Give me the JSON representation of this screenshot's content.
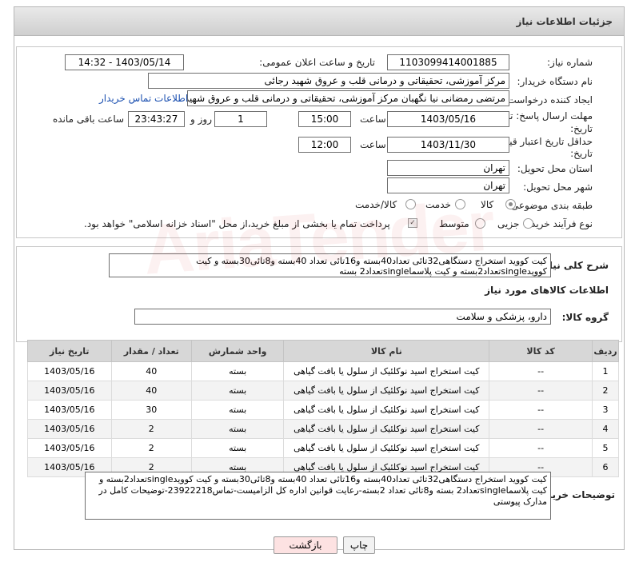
{
  "header": {
    "title": "جزئیات اطلاعات نیاز"
  },
  "fields": {
    "need_number_label": "شماره نیاز:",
    "need_number": "1103099414001885",
    "announce_label": "تاریخ و ساعت اعلان عمومی:",
    "announce_value": "1403/05/14 - 14:32",
    "buyer_label": "نام دستگاه خریدار:",
    "buyer_value": "مرکز آموزشی، تحقیقاتی و درمانی قلب و عروق شهید رجائی",
    "creator_label": "ایجاد کننده درخواست:",
    "creator_value": "مرتضی رمضانی نیا نگهبان مرکز آموزشی، تحقیقاتی و درمانی قلب و عروق شهید",
    "buyer_contact_link": "اطلاعات تماس خریدار",
    "deadline_label_1": "مهلت ارسال پاسخ: تا",
    "deadline_label_2": "تاریخ:",
    "deadline_date": "1403/05/16",
    "time_label": "ساعت",
    "deadline_time": "15:00",
    "days_value": "1",
    "days_label": "روز و",
    "remaining_time": "23:43:27",
    "remaining_label": "ساعت باقی مانده",
    "validity_label_1": "حداقل تاریخ اعتبار قیمت: تا",
    "validity_label_2": "تاریخ:",
    "validity_date": "1403/11/30",
    "validity_time_label": "ساعت",
    "validity_time": "12:00",
    "province_label": "استان محل تحویل:",
    "province_value": "تهران",
    "city_label": "شهر محل تحویل:",
    "city_value": "تهران",
    "category_label": "طبقه بندی موضوعی:",
    "category_options": [
      "کالا",
      "خدمت",
      "کالا/خدمت"
    ],
    "category_selected": "کالا",
    "process_label": "نوع فرآیند خرید :",
    "process_options": [
      "جزیی",
      "متوسط"
    ],
    "payment_note": "پرداخت تمام یا بخشی از مبلغ خرید،از محل \"اسناد خزانه اسلامی\" خواهد بود."
  },
  "description": {
    "label": "شرح کلی نیاز:",
    "text": "کیت کووید استخراج دستگاهی32تائی تعداد40بسته و16تائی تعداد 40بسته و8تائی30بسته و کیت کوویدsingleتعداد2بسته و کیت پلاسماsingleتعداد2 بسته"
  },
  "goods": {
    "section_title": "اطلاعات کالاهای مورد نیاز",
    "group_label": "گروه کالا:",
    "group_value": "دارو، پزشکی و سلامت",
    "columns": [
      "ردیف",
      "کد کالا",
      "نام کالا",
      "واحد شمارش",
      "تعداد / مقدار",
      "تاریخ نیاز"
    ],
    "rows": [
      {
        "row": "1",
        "code": "--",
        "name": "کیت استخراج اسید نوکلئیک از سلول یا بافت گیاهی",
        "unit": "بسته",
        "qty": "40",
        "date": "1403/05/16"
      },
      {
        "row": "2",
        "code": "--",
        "name": "کیت استخراج اسید نوکلئیک از سلول یا بافت گیاهی",
        "unit": "بسته",
        "qty": "40",
        "date": "1403/05/16"
      },
      {
        "row": "3",
        "code": "--",
        "name": "کیت استخراج اسید نوکلئیک از سلول یا بافت گیاهی",
        "unit": "بسته",
        "qty": "30",
        "date": "1403/05/16"
      },
      {
        "row": "4",
        "code": "--",
        "name": "کیت استخراج اسید نوکلئیک از سلول یا بافت گیاهی",
        "unit": "بسته",
        "qty": "2",
        "date": "1403/05/16"
      },
      {
        "row": "5",
        "code": "--",
        "name": "کیت استخراج اسید نوکلئیک از سلول یا بافت گیاهی",
        "unit": "بسته",
        "qty": "2",
        "date": "1403/05/16"
      },
      {
        "row": "6",
        "code": "--",
        "name": "کیت استخراج اسید نوکلئیک از سلول یا بافت گیاهی",
        "unit": "بسته",
        "qty": "2",
        "date": "1403/05/16"
      }
    ]
  },
  "buyer_notes": {
    "label": "توضیحات خریدار:",
    "text": "کیت کووید استخراج دستگاهی32تائی تعداد40بسته و16تائی تعداد 40بسته و8تائی30بسته و کیت کوویدsingleتعداد2بسته و کیت پلاسماsingleتعداد2 بسته و8تائی تعداد 2بسته-رعایت قوانین اداره کل الزامیست-تماس23922218-توضیحات کامل در مدارک پیوستی"
  },
  "buttons": {
    "print": "چاپ",
    "back": "بازگشت"
  },
  "colors": {
    "back_button_bg": "#fde2e2",
    "link": "#1a4fb0",
    "header_bg": "#d7d7d7"
  }
}
